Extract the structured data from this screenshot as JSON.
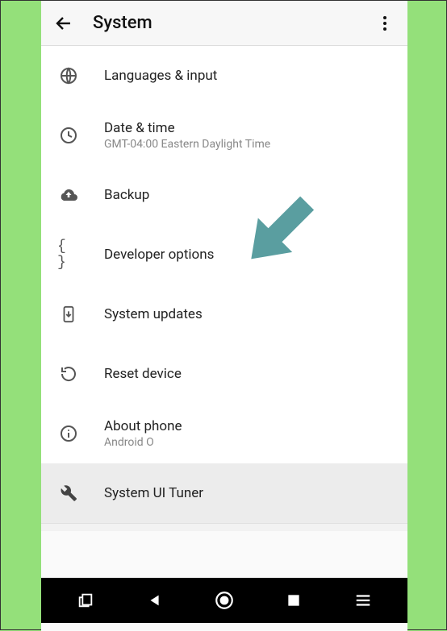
{
  "header": {
    "title": "System"
  },
  "items": [
    {
      "label": "Languages & input",
      "sub": null,
      "icon": "globe-icon"
    },
    {
      "label": "Date & time",
      "sub": "GMT-04:00 Eastern Daylight Time",
      "icon": "clock-icon"
    },
    {
      "label": "Backup",
      "sub": null,
      "icon": "backup-icon"
    },
    {
      "label": "Developer options",
      "sub": null,
      "icon": "braces-icon"
    },
    {
      "label": "System updates",
      "sub": null,
      "icon": "update-icon"
    },
    {
      "label": "Reset device",
      "sub": null,
      "icon": "reset-icon"
    },
    {
      "label": "About phone",
      "sub": "Android O",
      "icon": "info-icon"
    },
    {
      "label": "System UI Tuner",
      "sub": null,
      "icon": "wrench-icon"
    }
  ],
  "annotation": {
    "arrow_color": "#5a9ea0"
  }
}
